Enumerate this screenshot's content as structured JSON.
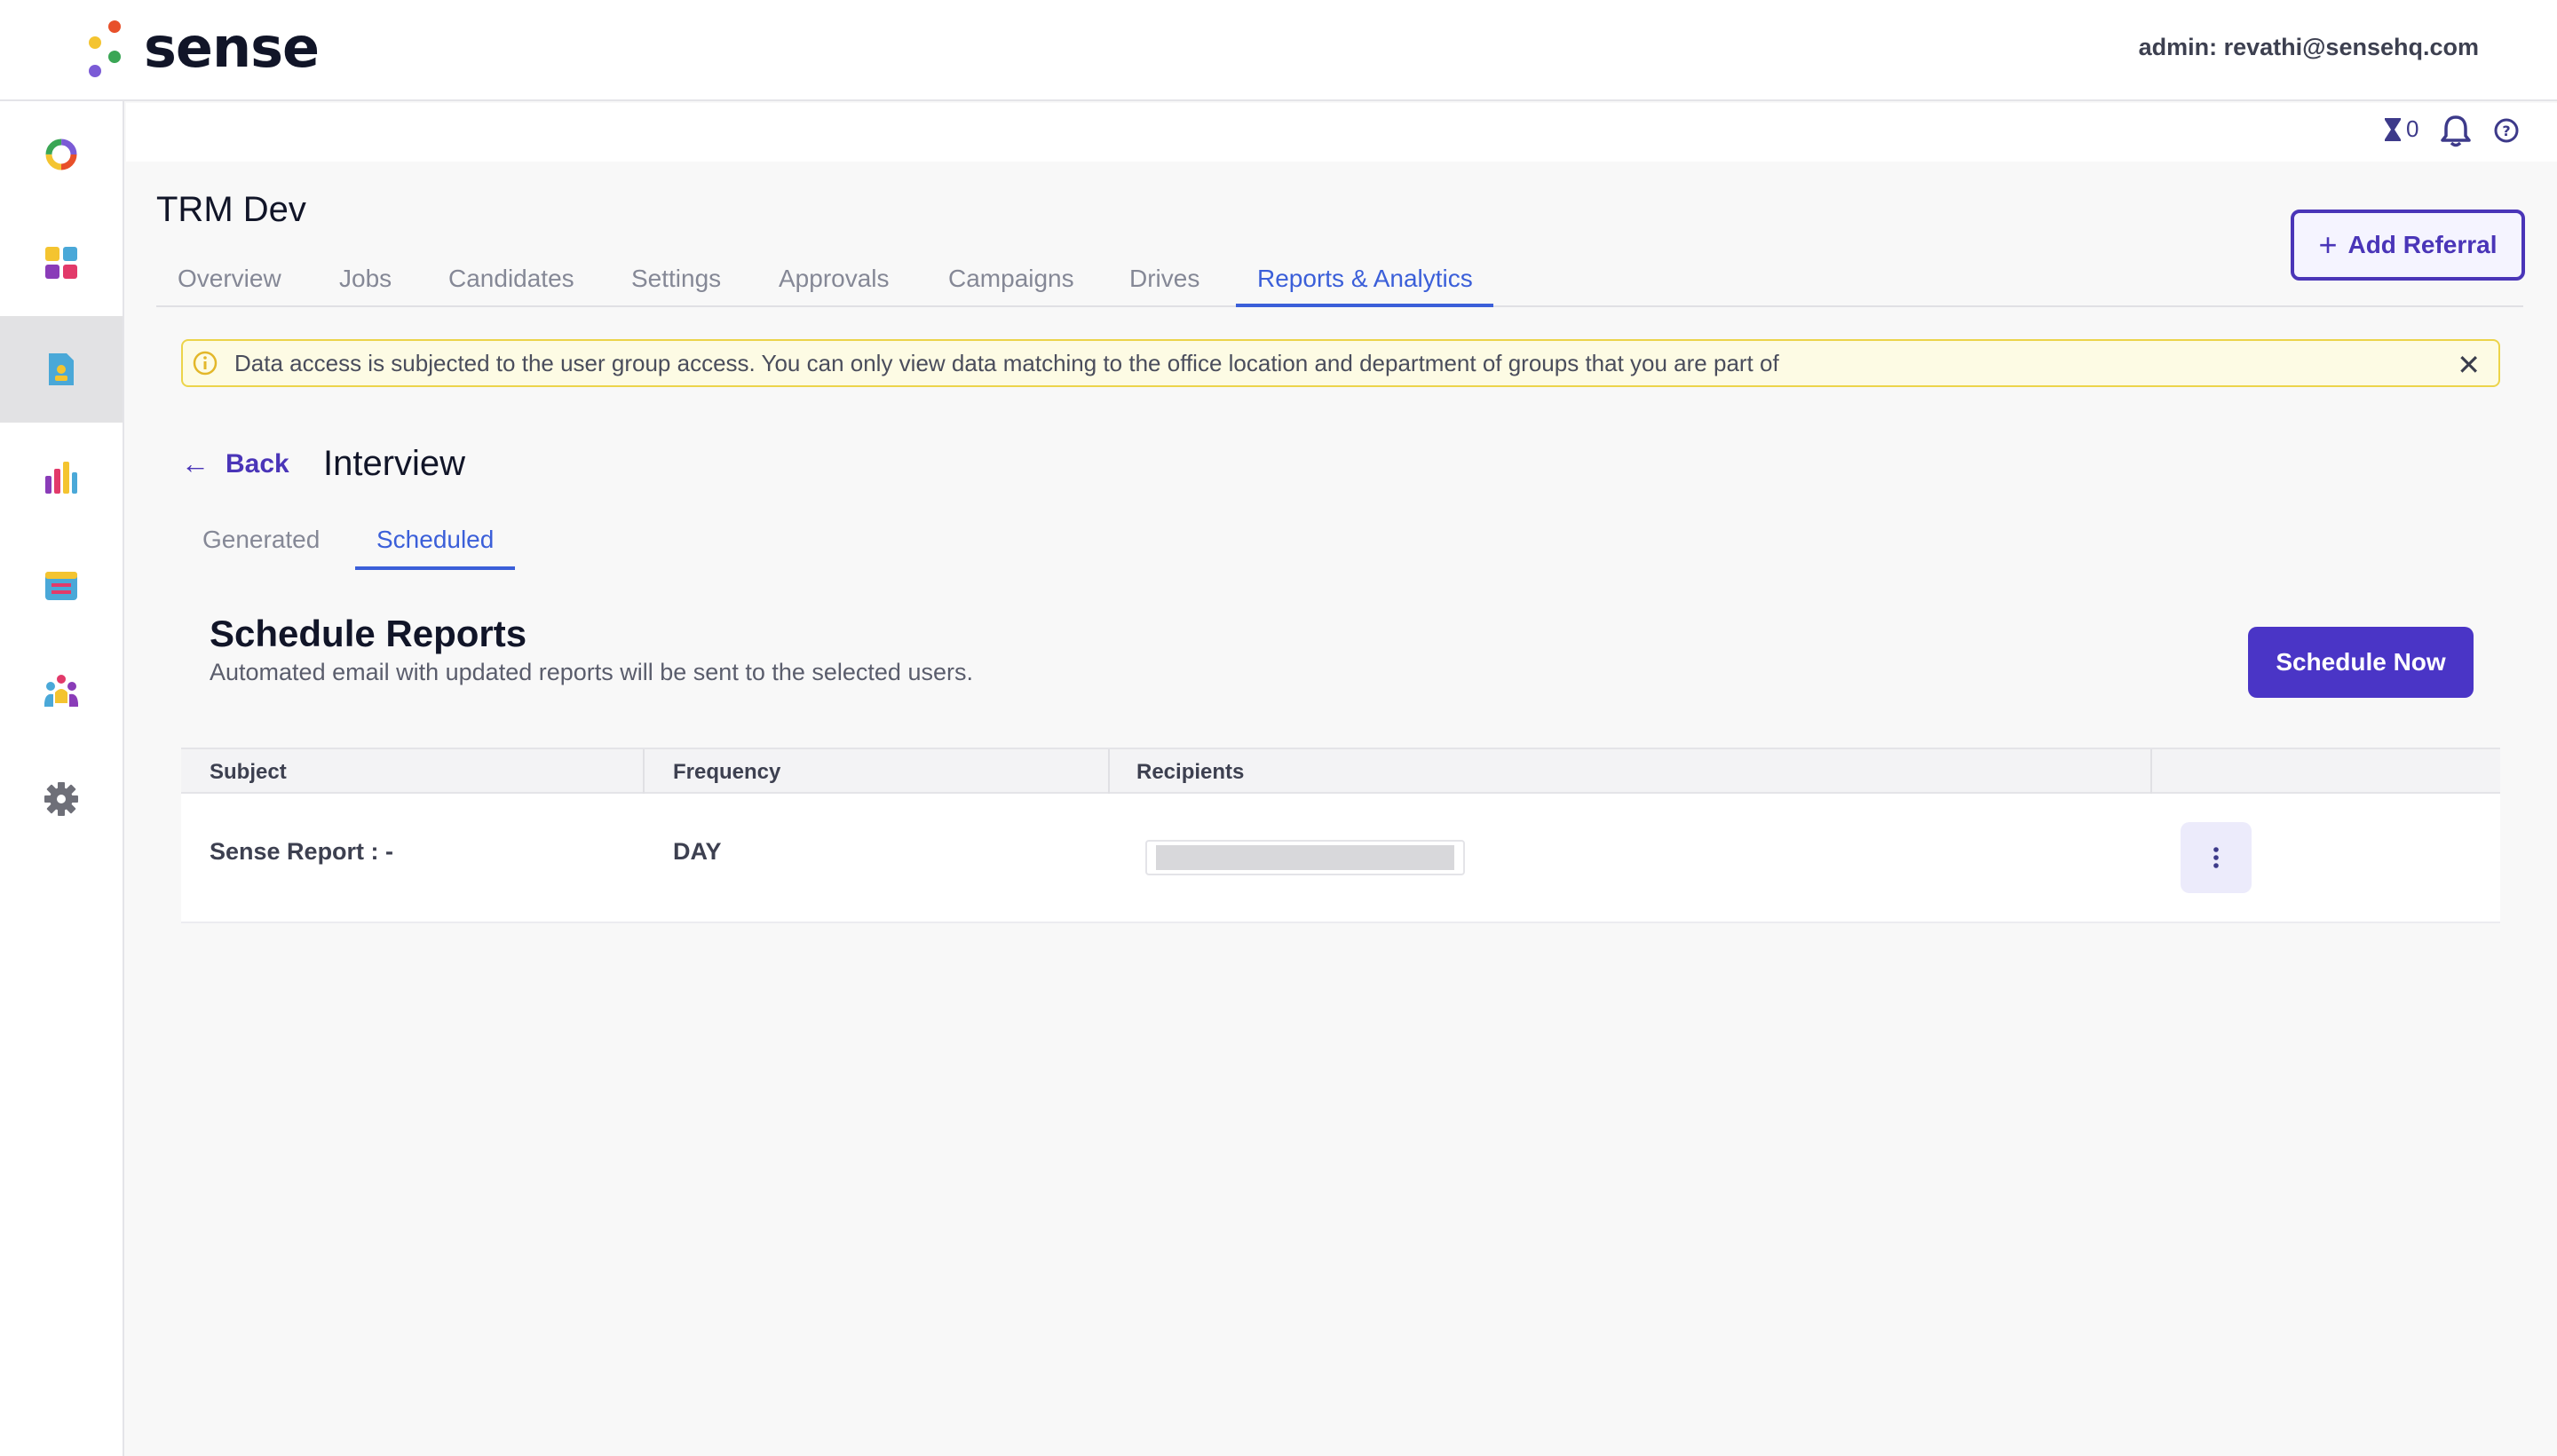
{
  "brand": {
    "name": "sense"
  },
  "header": {
    "admin": "admin: revathi@sensehq.com"
  },
  "sidebar": {
    "items": [
      "loop-icon",
      "dashboard-icon",
      "report-icon",
      "analytics-icon",
      "calendar-icon",
      "people-icon",
      "gear-icon"
    ],
    "active_index": 2
  },
  "utility": {
    "task_count": "0"
  },
  "org": {
    "title": "TRM Dev"
  },
  "tabs": [
    {
      "label": "Overview"
    },
    {
      "label": "Jobs"
    },
    {
      "label": "Candidates"
    },
    {
      "label": "Settings"
    },
    {
      "label": "Approvals"
    },
    {
      "label": "Campaigns"
    },
    {
      "label": "Drives"
    },
    {
      "label": "Reports & Analytics"
    }
  ],
  "actions": {
    "add_referral": "Add Referral"
  },
  "alert": {
    "text": "Data access is subjected to the user group access. You can only view data matching to the office location and department of groups that you are part of"
  },
  "nav": {
    "back": "Back",
    "page_title": "Interview"
  },
  "subtabs": [
    {
      "label": "Generated"
    },
    {
      "label": "Scheduled"
    }
  ],
  "schedule": {
    "title": "Schedule Reports",
    "description": "Automated email with updated reports will be sent to the selected users.",
    "button": "Schedule Now"
  },
  "table": {
    "columns": [
      "Subject",
      "Frequency",
      "Recipients"
    ],
    "rows": [
      {
        "subject": "Sense Report : -",
        "frequency": "DAY"
      }
    ]
  },
  "colors": {
    "accent": "#4a35c6",
    "link": "#3b5fd9",
    "alert_border": "#ecd44a"
  }
}
